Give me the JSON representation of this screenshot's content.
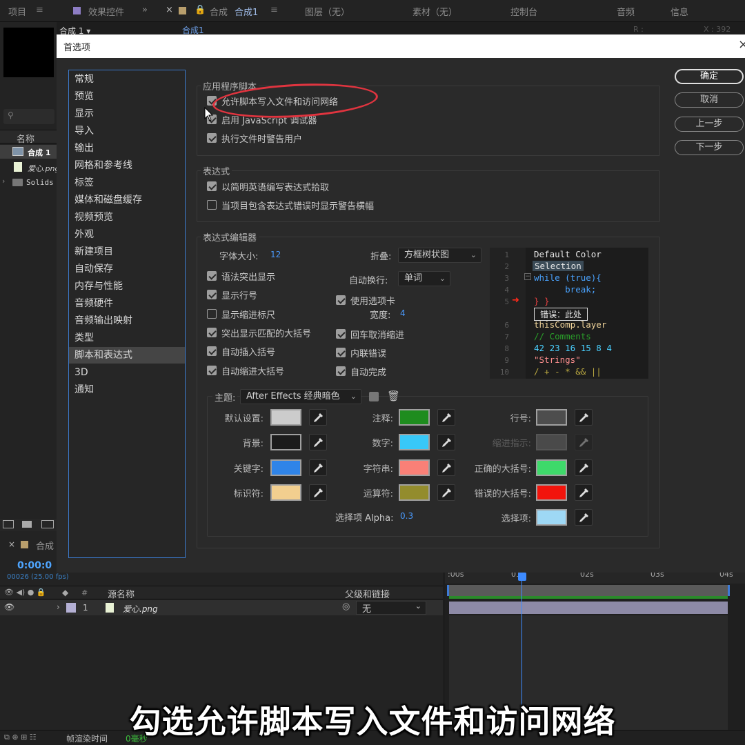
{
  "ae": {
    "tabs": [
      "项目",
      "效果控件",
      "合成",
      "合成1",
      "图层（无）",
      "素材（无）",
      "控制台",
      "音频",
      "信息"
    ],
    "comp_dropdown": "合成 1 ▾",
    "comp_tab": "合成1",
    "info_r": "R :",
    "info_x": "X : 392",
    "project_name_header": "名称",
    "project_items": [
      "合成 1",
      "爱心.png",
      "Solids"
    ],
    "timeline_tab": "合成",
    "timecode": "0:00:0",
    "fps": "00026 (25.00 fps)",
    "ruler_ticks": [
      ":00s",
      "01",
      "02s",
      "03s",
      "04s"
    ],
    "layer_header": {
      "source_name": "源名称",
      "parent": "父级和链接"
    },
    "layer": {
      "index": "1",
      "name": "爱心.png",
      "parent_value": "无"
    },
    "render_time_label": "帧渲染时间",
    "render_time_value": "0毫秒"
  },
  "dialog": {
    "title": "首选项",
    "close": "×",
    "categories": [
      "常规",
      "预览",
      "显示",
      "导入",
      "输出",
      "网格和参考线",
      "标签",
      "媒体和磁盘缓存",
      "视频预览",
      "外观",
      "新建项目",
      "自动保存",
      "内存与性能",
      "音频硬件",
      "音频输出映射",
      "类型",
      "脚本和表达式",
      "3D",
      "通知"
    ],
    "selected_category_index": 16,
    "buttons": {
      "ok": "确定",
      "cancel": "取消",
      "prev": "上一步",
      "next": "下一步"
    },
    "app_scripts": {
      "title": "应用程序脚本",
      "options": [
        {
          "label": "允许脚本写入文件和访问网络",
          "checked": true
        },
        {
          "label": "启用 JavaScript 调试器",
          "checked": true
        },
        {
          "label": "执行文件时警告用户",
          "checked": true
        }
      ]
    },
    "expressions": {
      "title": "表达式",
      "options": [
        {
          "label": "以简明英语编写表达式拾取",
          "checked": true
        },
        {
          "label": "当项目包含表达式错误时显示警告横幅",
          "checked": false
        }
      ]
    },
    "editor": {
      "title": "表达式编辑器",
      "font_size_label": "字体大小:",
      "font_size_value": "12",
      "fold_label": "折叠:",
      "fold_value": "方框树状图",
      "wrap_label": "自动换行:",
      "wrap_value": "单词",
      "tabs_label": "使用选项卡",
      "tabs_checked": true,
      "width_label": "宽度:",
      "width_value": "4",
      "left_options": [
        {
          "label": "语法突出显示",
          "checked": true
        },
        {
          "label": "显示行号",
          "checked": true
        },
        {
          "label": "显示缩进标尺",
          "checked": false
        },
        {
          "label": "突出显示匹配的大括号",
          "checked": true
        },
        {
          "label": "自动插入括号",
          "checked": true
        },
        {
          "label": "自动缩进大括号",
          "checked": true
        }
      ],
      "right_options": [
        {
          "label": "回车取消缩进",
          "checked": true
        },
        {
          "label": "内联错误",
          "checked": true
        },
        {
          "label": "自动完成",
          "checked": true
        }
      ],
      "code_lines": [
        {
          "n": "1",
          "text": "Default Color",
          "color": "#e6e6e6"
        },
        {
          "n": "2",
          "text": "Selection",
          "color": "#e6e6e6"
        },
        {
          "n": "3",
          "text": "while (true){",
          "color": "#4aa3ff"
        },
        {
          "n": "4",
          "text": "      break;",
          "color": "#4aa3ff"
        },
        {
          "n": "5",
          "text": "} }",
          "color": "#e04040"
        },
        {
          "n": "",
          "text": "错误：此处",
          "color": "#e6e6e6"
        },
        {
          "n": "6",
          "text": "thisComp.layer",
          "color": "#f0d49a"
        },
        {
          "n": "7",
          "text": "// Comments",
          "color": "#2aa02a"
        },
        {
          "n": "8",
          "text": "42 23 16 15 8 4",
          "color": "#4ad0ff"
        },
        {
          "n": "9",
          "text": "\"Strings\"",
          "color": "#ff8f8f"
        },
        {
          "n": "10",
          "text": "/ + - * && ||",
          "color": "#b8a640"
        }
      ],
      "theme_label": "主题:",
      "theme_value": "After Effects 经典暗色",
      "colors": [
        {
          "label": "默认设置:",
          "color": "#cccccc"
        },
        {
          "label": "背景:",
          "color": "#1c1c1c"
        },
        {
          "label": "关键字:",
          "color": "#2f84e8"
        },
        {
          "label": "标识符:",
          "color": "#f2cf8f"
        },
        {
          "label": "注释:",
          "color": "#1e8c1e"
        },
        {
          "label": "数字:",
          "color": "#38c8f8"
        },
        {
          "label": "字符串:",
          "color": "#f98077"
        },
        {
          "label": "运算符:",
          "color": "#938c2d"
        },
        {
          "label": "行号:",
          "color": "#4d4d4d"
        },
        {
          "label": "缩进指示:",
          "color": "#4a4a4a"
        },
        {
          "label": "正确的大括号:",
          "color": "#3ed96a"
        },
        {
          "label": "错误的大括号:",
          "color": "#f2140c"
        },
        {
          "label": "选择项:",
          "color": "#9ed8f5"
        }
      ],
      "alpha_label": "选择项 Alpha:",
      "alpha_value": "0.3"
    }
  },
  "caption": "勾选允许脚本写入文件和访问网络",
  "annotation_color": "#e0343f"
}
